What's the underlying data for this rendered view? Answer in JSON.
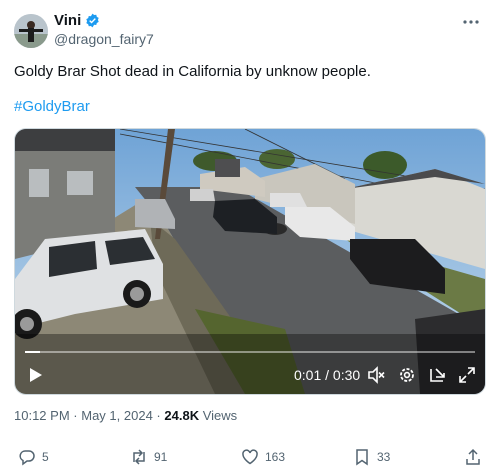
{
  "author": {
    "name": "Vini",
    "handle": "@dragon_fairy7",
    "verified": true
  },
  "post": {
    "text": "Goldy Brar Shot dead in California by unknow people.",
    "hashtag": "#GoldyBrar"
  },
  "video": {
    "current_time": "0:01",
    "duration": "0:30",
    "time_display": "0:01 / 0:30",
    "progress_fraction": 0.033
  },
  "meta": {
    "time": "10:12 PM",
    "date": "May 1, 2024",
    "separator": "·",
    "views_count": "24.8K",
    "views_label": "Views"
  },
  "actions": {
    "replies": "5",
    "reposts": "91",
    "likes": "163",
    "bookmarks": "33"
  },
  "icons": [
    "more-icon",
    "verified-icon",
    "play-icon",
    "volume-mute-icon",
    "settings-icon",
    "minimize-icon",
    "fullscreen-icon",
    "reply-icon",
    "repost-icon",
    "like-icon",
    "bookmark-icon",
    "share-icon"
  ],
  "colors": {
    "accent": "#1d9bf0",
    "text": "#0f1419",
    "muted": "#536471"
  }
}
